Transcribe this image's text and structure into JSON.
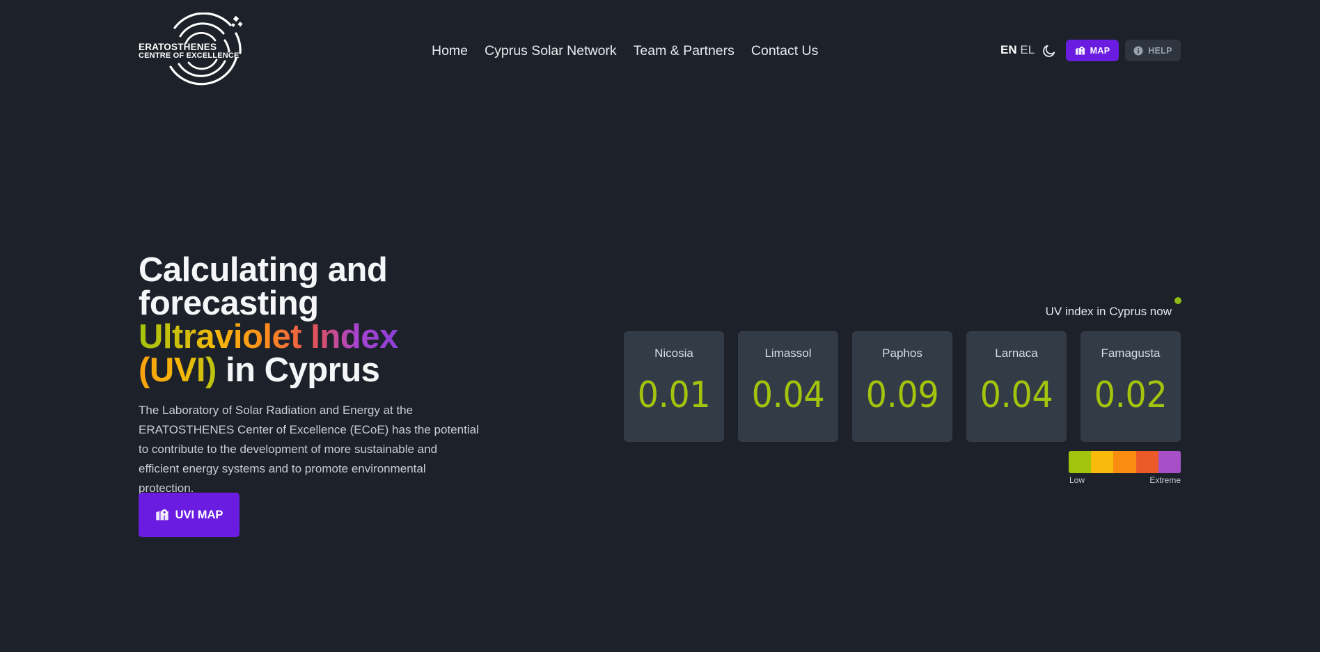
{
  "logo": {
    "line1": "ERATOSTHENES",
    "line2": "CENTRE OF EXCELLENCE"
  },
  "nav": {
    "items": [
      "Home",
      "Cyprus Solar Network",
      "Team & Partners",
      "Contact Us"
    ]
  },
  "lang": {
    "active": "EN",
    "other": "EL"
  },
  "toolbar": {
    "map_label": "MAP",
    "help_label": "HELP"
  },
  "hero": {
    "title_line1": "Calculating and",
    "title_line2": "forecasting",
    "title_highlight": "Ultraviolet Index",
    "title_highlight2": "(UVI)",
    "title_tail": "in Cyprus",
    "description": "The Laboratory of Solar Radiation and Energy at the ERATOSTHENES Center of Excellence (ECoE) has the potential to contribute to the development of more sustainable and efficient energy systems and to promote environmental protection.",
    "cta_label": "UVI MAP"
  },
  "uv": {
    "caption": "UV index in Cyprus now",
    "cities": [
      {
        "name": "Nicosia",
        "value": "0.01"
      },
      {
        "name": "Limassol",
        "value": "0.04"
      },
      {
        "name": "Paphos",
        "value": "0.09"
      },
      {
        "name": "Larnaca",
        "value": "0.04"
      },
      {
        "name": "Famagusta",
        "value": "0.02"
      }
    ],
    "scale": {
      "low_label": "Low",
      "high_label": "Extreme",
      "colors": [
        "#a3c40d",
        "#f8bb0b",
        "#fb8c12",
        "#ed5a2a",
        "#a64fc7"
      ]
    }
  },
  "colors": {
    "accent": "#6a1de0",
    "uv_value": "#a3c40d",
    "live_dot": "#8fbb16"
  }
}
